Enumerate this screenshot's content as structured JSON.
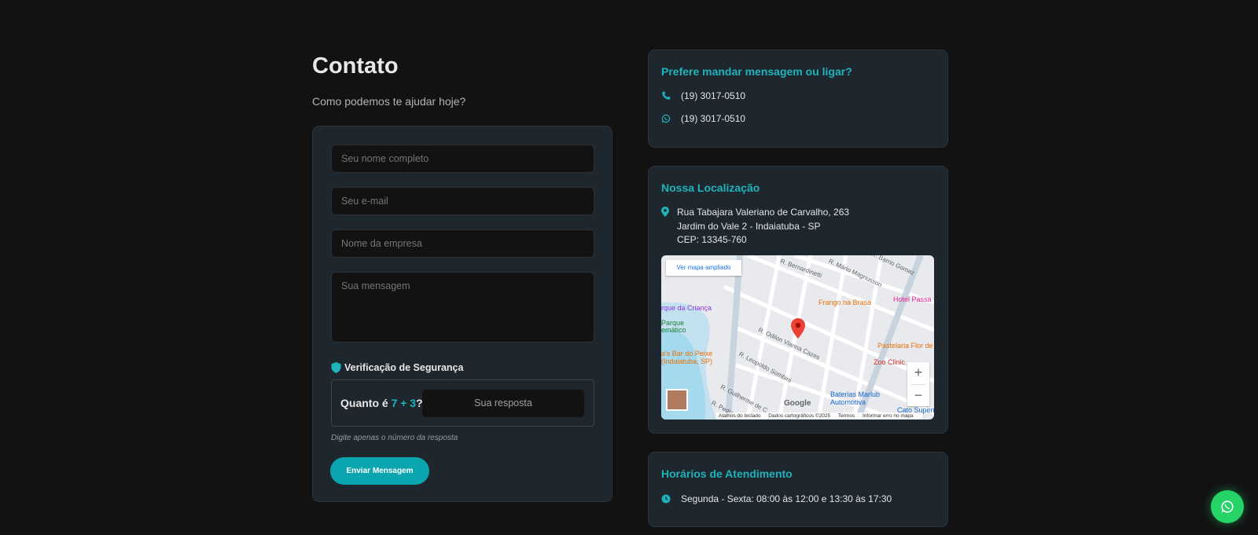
{
  "header": {
    "title": "Contato",
    "subtitle": "Como podemos te ajudar hoje?"
  },
  "form": {
    "name_placeholder": "Seu nome completo",
    "email_placeholder": "Seu e-mail",
    "company_placeholder": "Nome da empresa",
    "message_placeholder": "Sua mensagem",
    "security_title": "Verificação de Segurança",
    "captcha_prefix": "Quanto é",
    "captcha_expression": "7 + 3",
    "captcha_suffix": "?",
    "captcha_placeholder": "Sua resposta",
    "hint": "Digite apenas o número da resposta",
    "submit_label": "Enviar Mensagem"
  },
  "contact_card": {
    "title": "Prefere mandar mensagem ou ligar?",
    "phone": "(19) 3017-0510",
    "whatsapp": "(19) 3017-0510"
  },
  "location_card": {
    "title": "Nossa Localização",
    "address_line1": "Rua Tabajara Valeriano de Carvalho, 263",
    "address_line2": "Jardim do Vale 2 - Indaiatuba - SP",
    "address_line3": "CEP: 13345-760",
    "map": {
      "view_larger": "Ver mapa ampliado",
      "zoom_in": "+",
      "zoom_out": "−",
      "google": "Google",
      "attrib_shortcuts": "Atalhos do teclado",
      "attrib_data": "Dados cartográficos ©2025",
      "attrib_terms": "Termos",
      "attrib_report": "Informar erro no mapa",
      "places": {
        "frango": "Frango na Brasa",
        "hotel": "Hotel Passa",
        "parque_crianca": "rque da Criança",
        "parque_tematico": "Parque\nemático",
        "bar_peixe": "a's Bar do Peixe\n(Indaiatuba, SP)",
        "pastelaria": "Pastelaria Flor de",
        "zoo": "Zoo Clinic",
        "baterias": "Baterias Marlub\nAutomotiva",
        "cato": "Cato Superm"
      },
      "streets": {
        "bernardinetti": "R. Bernardinetti",
        "magnusson": "R. Mário Magnusson",
        "barrio": "R. Barrio Gomez",
        "odilon": "R. Odilon Vianna Cazes",
        "leopoldo": "R. Leopoldo Sombini",
        "guilherme": "R. Guilherme de C",
        "pedro": "R. Pedro S"
      }
    }
  },
  "hours_card": {
    "title": "Horários de Atendimento",
    "weekday": "Segunda - Sexta: 08:00 às 12:00 e 13:30 às 17:30"
  },
  "colors": {
    "accent": "#1fb3bb",
    "button": "#0aa5ae",
    "whatsapp": "#25d366",
    "card": "#1e262e",
    "background": "#121212"
  }
}
